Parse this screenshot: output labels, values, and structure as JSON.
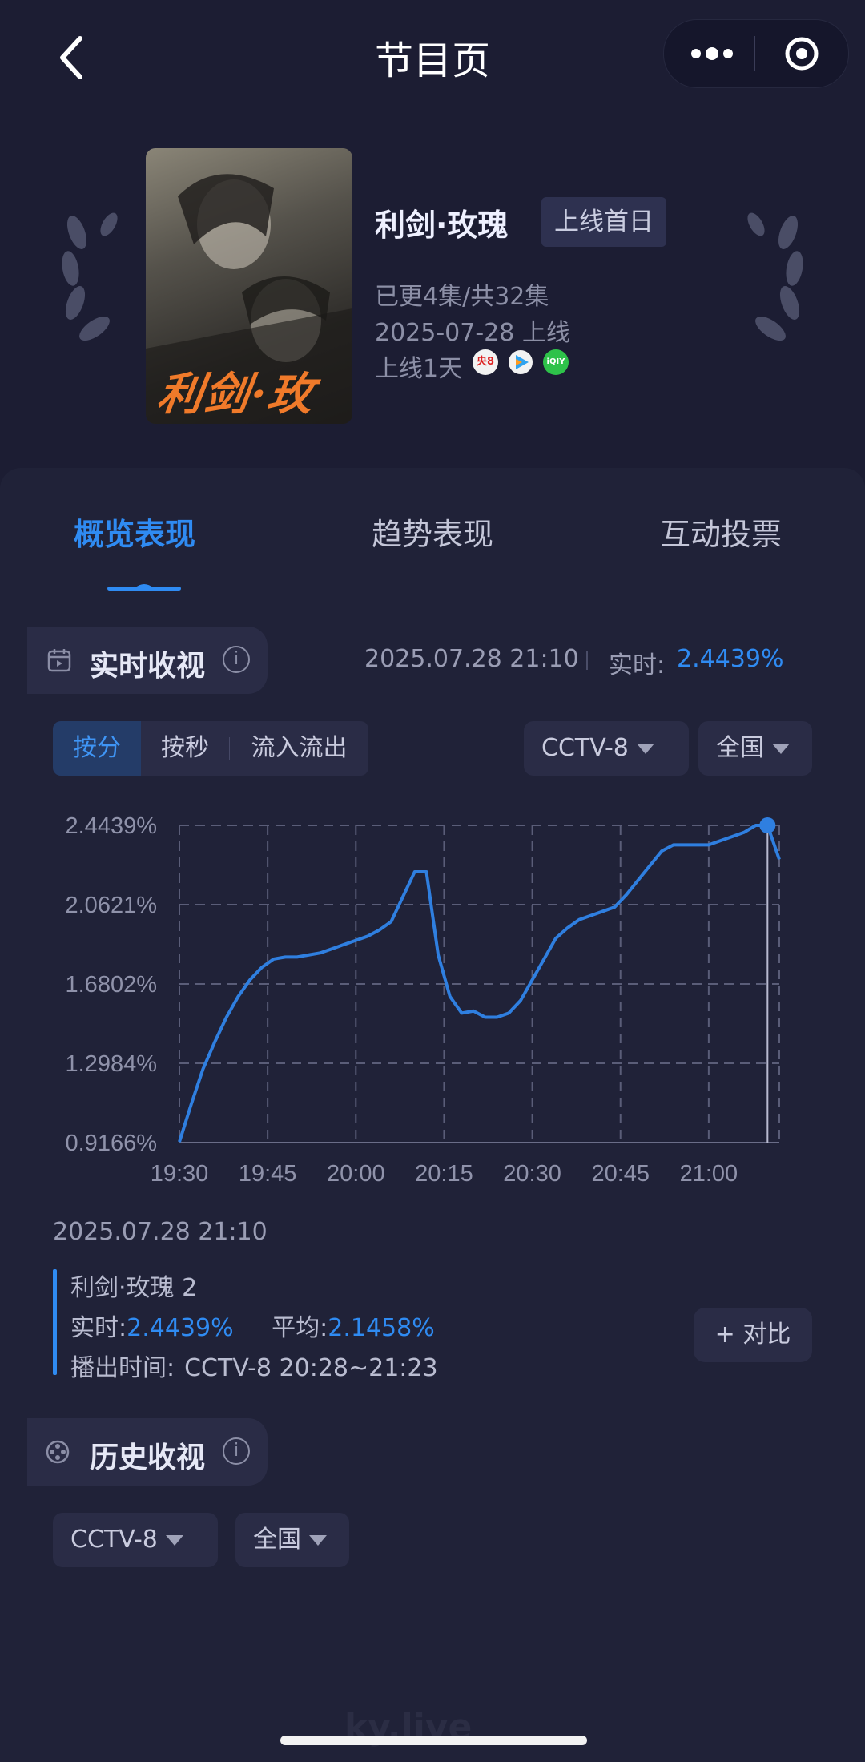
{
  "nav": {
    "title": "节目页"
  },
  "program": {
    "poster_text": "利剑·玫瑰",
    "title": "利剑·玫瑰",
    "badge": "上线首日",
    "episodes": "已更4集/共32集",
    "date": "2025-07-28 上线",
    "days": "上线1天",
    "platforms": [
      {
        "name": "cctv8-icon",
        "color": "#e44",
        "label": "央8"
      },
      {
        "name": "tencent-video-icon",
        "color": "#2fa3f0",
        "label": ""
      },
      {
        "name": "iqiyi-icon",
        "color": "#2ec24a",
        "label": "iQIY"
      }
    ]
  },
  "tabs": [
    {
      "label": "概览表现",
      "active": true
    },
    {
      "label": "趋势表现",
      "active": false
    },
    {
      "label": "互动投票",
      "active": false
    }
  ],
  "realtime": {
    "title": "实时收视",
    "info": "i",
    "timestamp": "2025.07.28 21:10",
    "label": "实时:",
    "value": "2.4439%"
  },
  "segments": [
    "按分",
    "按秒",
    "流入流出"
  ],
  "filters": {
    "channel": "CCTV-8",
    "region": "全国"
  },
  "chart_data": {
    "type": "line",
    "title": "",
    "xlabel": "",
    "ylabel": "",
    "x_ticks": [
      "19:30",
      "19:45",
      "20:00",
      "20:15",
      "20:30",
      "20:45",
      "21:00"
    ],
    "y_ticks": [
      "2.4439%",
      "2.0621%",
      "1.6802%",
      "1.2984%",
      "0.9166%"
    ],
    "ylim": [
      0.9166,
      2.4439
    ],
    "grid": true,
    "series": [
      {
        "x": [
          "19:30",
          "19:32",
          "19:34",
          "19:36",
          "19:38",
          "19:40",
          "19:42",
          "19:44",
          "19:46",
          "19:48",
          "19:50",
          "19:52",
          "19:54",
          "19:56",
          "19:58",
          "20:00",
          "20:02",
          "20:04",
          "20:06",
          "20:08",
          "20:10",
          "20:12",
          "20:14",
          "20:16",
          "20:18",
          "20:20",
          "20:22",
          "20:24",
          "20:26",
          "20:28",
          "20:30",
          "20:32",
          "20:34",
          "20:36",
          "20:38",
          "20:40",
          "20:42",
          "20:44",
          "20:46",
          "20:48",
          "20:50",
          "20:52",
          "20:54",
          "20:56",
          "20:58",
          "21:00",
          "21:02",
          "21:04",
          "21:06",
          "21:08",
          "21:10",
          "21:12"
        ],
        "values": [
          0.92,
          1.1,
          1.27,
          1.4,
          1.52,
          1.62,
          1.7,
          1.76,
          1.8,
          1.81,
          1.81,
          1.82,
          1.83,
          1.85,
          1.87,
          1.89,
          1.91,
          1.94,
          1.98,
          2.1,
          2.22,
          2.22,
          1.82,
          1.62,
          1.54,
          1.55,
          1.52,
          1.52,
          1.54,
          1.6,
          1.7,
          1.8,
          1.9,
          1.95,
          1.99,
          2.01,
          2.03,
          2.05,
          2.11,
          2.18,
          2.25,
          2.32,
          2.35,
          2.35,
          2.35,
          2.35,
          2.37,
          2.39,
          2.41,
          2.4439,
          2.4439,
          2.28
        ]
      }
    ]
  },
  "legend": {
    "date": "2025.07.28 21:10",
    "series_name": "利剑·玫瑰 2",
    "rt_label": "实时:",
    "rt_value": "2.4439%",
    "avg_label": "平均:",
    "avg_value": "2.1458%",
    "air_label": "播出时间:",
    "air_value": "CCTV-8 20:28~21:23",
    "compare_label": "+ 对比"
  },
  "history": {
    "title": "历史收视",
    "info": "i",
    "channel": "CCTV-8",
    "region": "全国"
  },
  "watermark": "ky.live"
}
